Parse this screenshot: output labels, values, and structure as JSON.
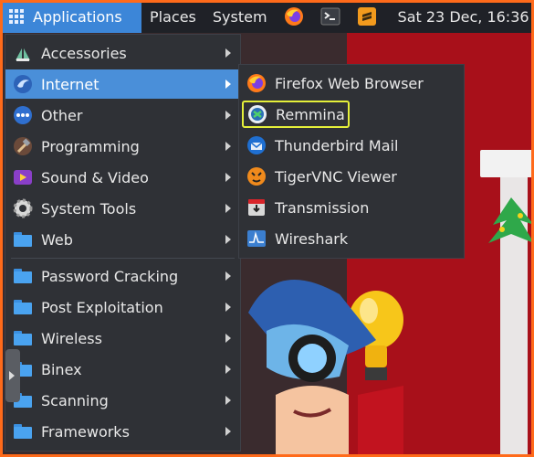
{
  "panel": {
    "applications_label": "Applications",
    "places_label": "Places",
    "system_label": "System",
    "clock": "Sat 23 Dec, 16:36"
  },
  "menu": {
    "items": [
      {
        "label": "Accessories",
        "icon": "accessories-icon"
      },
      {
        "label": "Internet",
        "icon": "internet-icon"
      },
      {
        "label": "Other",
        "icon": "other-icon"
      },
      {
        "label": "Programming",
        "icon": "programming-icon"
      },
      {
        "label": "Sound & Video",
        "icon": "sound-video-icon"
      },
      {
        "label": "System Tools",
        "icon": "system-tools-icon"
      },
      {
        "label": "Web",
        "icon": "folder-icon"
      },
      {
        "label": "Password Cracking",
        "icon": "folder-icon"
      },
      {
        "label": "Post Exploitation",
        "icon": "folder-icon"
      },
      {
        "label": "Wireless",
        "icon": "folder-icon"
      },
      {
        "label": "Binex",
        "icon": "folder-icon"
      },
      {
        "label": "Scanning",
        "icon": "folder-icon"
      },
      {
        "label": "Frameworks",
        "icon": "folder-icon"
      }
    ],
    "selected": "Internet"
  },
  "submenu": {
    "items": [
      {
        "label": "Firefox Web Browser",
        "icon": "firefox-icon"
      },
      {
        "label": "Remmina",
        "icon": "remmina-icon"
      },
      {
        "label": "Thunderbird Mail",
        "icon": "thunderbird-icon"
      },
      {
        "label": "TigerVNC Viewer",
        "icon": "tigervnc-icon"
      },
      {
        "label": "Transmission",
        "icon": "transmission-icon"
      },
      {
        "label": "Wireshark",
        "icon": "wireshark-icon"
      }
    ],
    "focused": "Remmina"
  },
  "colors": {
    "accent": "#4a8fd9",
    "panel": "#1f2127",
    "menu_bg": "#2f3136",
    "focus_ring": "#e5f03a",
    "border_highlight": "#ff6a1a"
  }
}
